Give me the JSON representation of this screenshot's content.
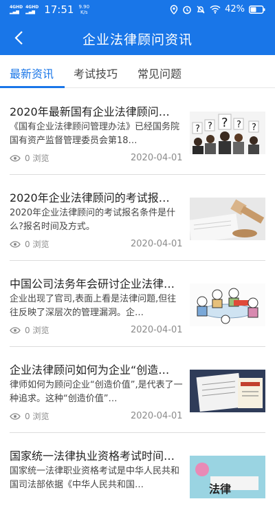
{
  "status_bar": {
    "net1": "4GHD",
    "net2": "4GHD",
    "time": "17:51",
    "speed_value": "9.90",
    "speed_unit": "K/s",
    "battery": "42%"
  },
  "app_bar": {
    "title": "企业法律顾问资讯"
  },
  "tabs": [
    {
      "label": "最新资讯"
    },
    {
      "label": "考试技巧"
    },
    {
      "label": "常见问题"
    }
  ],
  "articles": [
    {
      "title": "2020年最新国有企业法律顾问…",
      "desc": "《国有企业法律顾问管理办法》已经国务院国有资产监督管理委员会第18…",
      "views": "0 浏览",
      "date": "2020-04-01",
      "thumb": "question-people"
    },
    {
      "title": "2020年企业法律顾问的考试报…",
      "desc": "2020年企业法律顾问的考试报名条件是什么?报名时间及方式。",
      "views": "0 浏览",
      "date": "2020-04-01",
      "thumb": "gavel-desk"
    },
    {
      "title": "中国公司法务年会研讨企业法律…",
      "desc": "企业出现了官司,表面上看是法律问题,但往往反映了深层次的管理漏洞。企…",
      "views": "0 浏览",
      "date": "2020-04-01",
      "thumb": "cartoon-meeting"
    },
    {
      "title": "企业法律顾问如何为企业“创造…",
      "desc": "律师如何为顾问企业“创造价值”,是代表了一种追求。这种“创造价值”…",
      "views": "0 浏览",
      "date": "2020-04-01",
      "thumb": "book-cover"
    },
    {
      "title": "国家统一法律执业资格考试时间…",
      "desc": "国家统一法律职业资格考试是中华人民共和国司法部依据《中华人民共和国…",
      "views": "",
      "date": "",
      "thumb": "law-banner",
      "thumb_text": "法律"
    }
  ]
}
